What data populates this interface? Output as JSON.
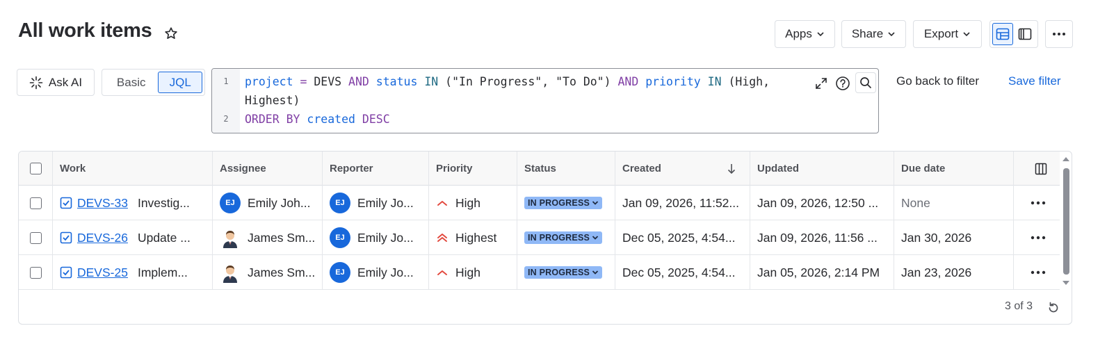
{
  "header": {
    "title": "All work items",
    "apps_label": "Apps",
    "share_label": "Share",
    "export_label": "Export"
  },
  "search": {
    "ask_ai_label": "Ask AI",
    "mode_basic": "Basic",
    "mode_jql": "JQL",
    "line1_no": "1",
    "line2_no": "2",
    "go_back_label": "Go back to filter",
    "save_filter_label": "Save filter"
  },
  "jql": {
    "t1": "project",
    "t2": " = ",
    "t3": "DEVS ",
    "t4": "AND",
    "t5": " status",
    "t6": " IN",
    "t7": " (\"In Progress\", \"To Do\") ",
    "t8": "AND",
    "t9": " priority",
    "t10": " IN",
    "t11": " (High,",
    "t12": "Highest)",
    "t13": "ORDER BY",
    "t14": " created",
    "t15": " DESC"
  },
  "table": {
    "columns": {
      "work": "Work",
      "assignee": "Assignee",
      "reporter": "Reporter",
      "priority": "Priority",
      "status": "Status",
      "created": "Created",
      "updated": "Updated",
      "due": "Due date"
    },
    "rows": [
      {
        "key": "DEVS-33",
        "summary": "Investig...",
        "assignee": "Emily Joh...",
        "assignee_initials": "EJ",
        "reporter": "Emily Jo...",
        "reporter_initials": "EJ",
        "priority": "High",
        "status": "IN PROGRESS",
        "created": "Jan 09, 2026, 11:52...",
        "updated": "Jan 09, 2026, 12:50 ...",
        "due": "None"
      },
      {
        "key": "DEVS-26",
        "summary": "Update ...",
        "assignee": "James Sm...",
        "reporter": "Emily Jo...",
        "reporter_initials": "EJ",
        "priority": "Highest",
        "status": "IN PROGRESS",
        "created": "Dec 05, 2025, 4:54...",
        "updated": "Jan 09, 2026, 11:56 ...",
        "due": "Jan 30, 2026"
      },
      {
        "key": "DEVS-25",
        "summary": "Implem...",
        "assignee": "James Sm...",
        "reporter": "Emily Jo...",
        "reporter_initials": "EJ",
        "priority": "High",
        "status": "IN PROGRESS",
        "created": "Dec 05, 2025, 4:54...",
        "updated": "Jan 05, 2026, 2:14 PM",
        "due": "Jan 23, 2026"
      }
    ],
    "count_label": "3 of 3"
  },
  "colors": {
    "brand": "#1868db",
    "status_bg": "#8fb8f6",
    "priority_high": "#e2483d"
  }
}
